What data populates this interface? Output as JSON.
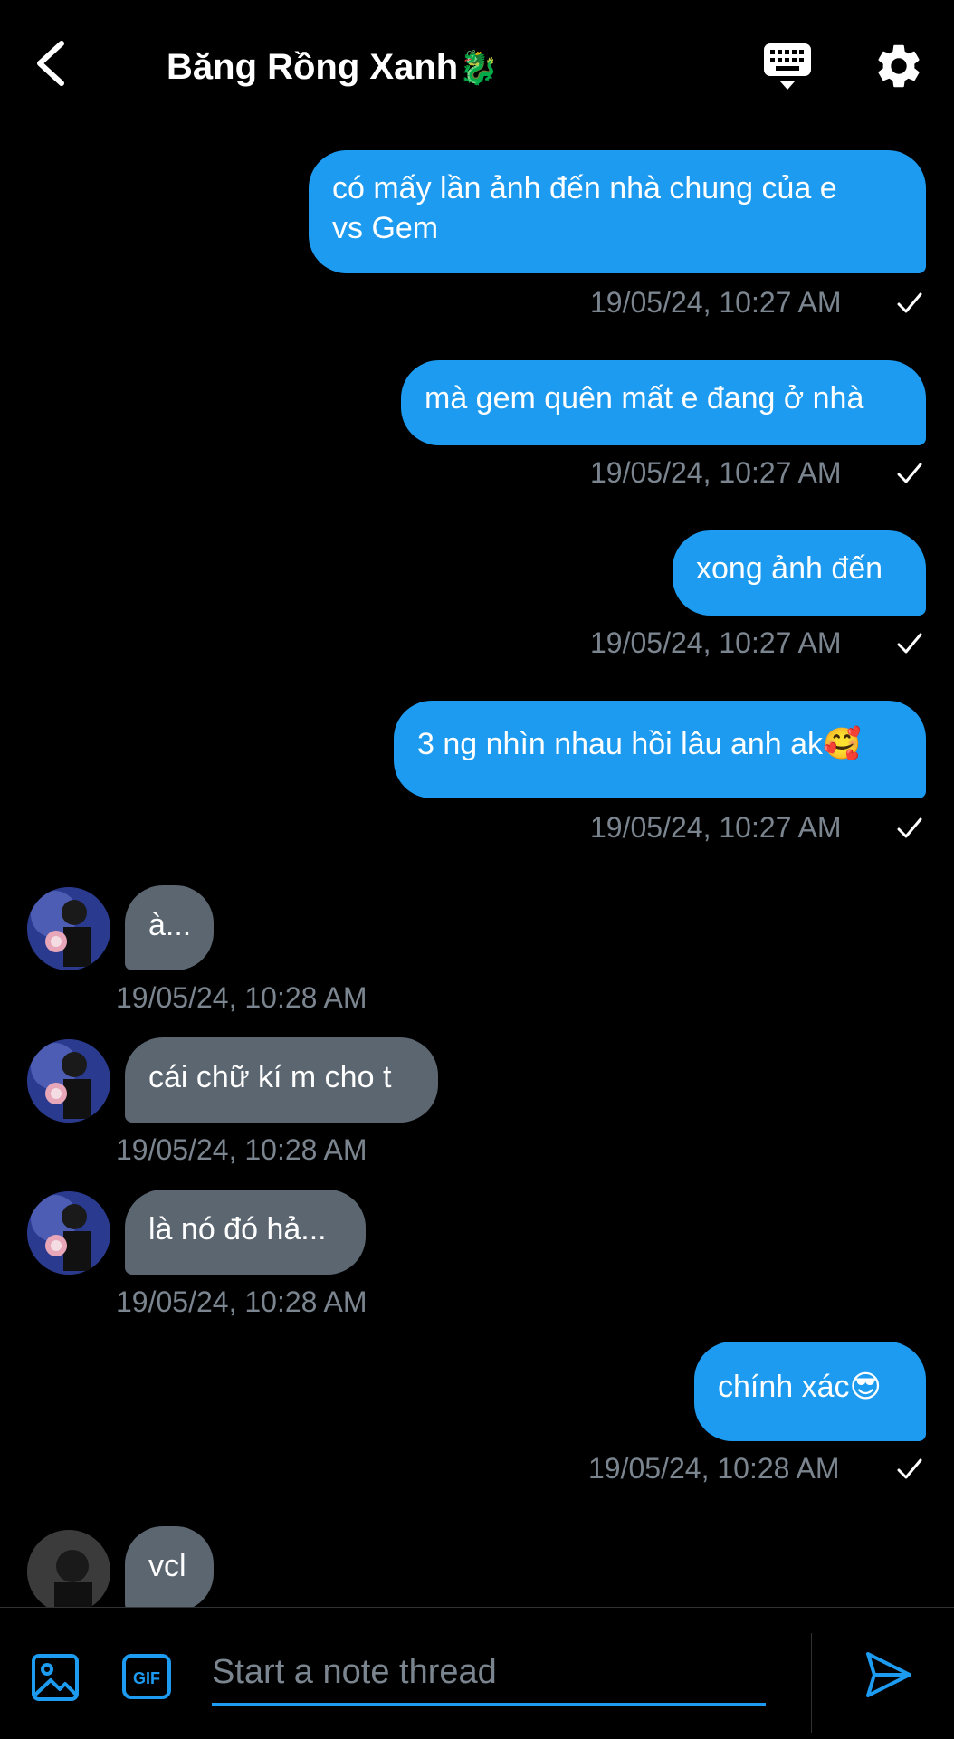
{
  "header": {
    "title": "Băng Rồng Xanh",
    "title_emoji": "🐉",
    "icons": [
      "back-icon",
      "keyboard-icon",
      "gear-icon"
    ]
  },
  "messages": [
    {
      "dir": "out",
      "lines": [
        "có mấy lần ảnh đến nhà chung của e",
        "vs Gem"
      ],
      "time": "19/05/24, 10:27 AM"
    },
    {
      "dir": "out",
      "lines": [
        "mà gem quên mất e đang ở nhà"
      ],
      "time": "19/05/24, 10:27 AM"
    },
    {
      "dir": "out",
      "lines": [
        "xong ảnh đến"
      ],
      "time": "19/05/24, 10:27 AM"
    },
    {
      "dir": "out",
      "lines": [
        "3 ng nhìn nhau hồi lâu anh ak🥰"
      ],
      "time": "19/05/24, 10:27 AM"
    },
    {
      "dir": "in",
      "lines": [
        "à..."
      ],
      "time": "19/05/24, 10:28 AM"
    },
    {
      "dir": "in",
      "lines": [
        "cái chữ kí m cho t"
      ],
      "time": "19/05/24, 10:28 AM"
    },
    {
      "dir": "in",
      "lines": [
        "là nó đó hả..."
      ],
      "time": "19/05/24, 10:28 AM"
    },
    {
      "dir": "out",
      "lines": [
        "chính xác😎"
      ],
      "time": "19/05/24, 10:28 AM"
    },
    {
      "dir": "in",
      "lines": [
        "vcl"
      ],
      "time": ""
    }
  ],
  "composer": {
    "placeholder": "Start a note thread",
    "gif_label": "GIF"
  },
  "colors": {
    "accent": "#1d9bf0",
    "incoming_bubble": "#5b6671",
    "timestamp": "#7b858f",
    "background": "#000000"
  }
}
